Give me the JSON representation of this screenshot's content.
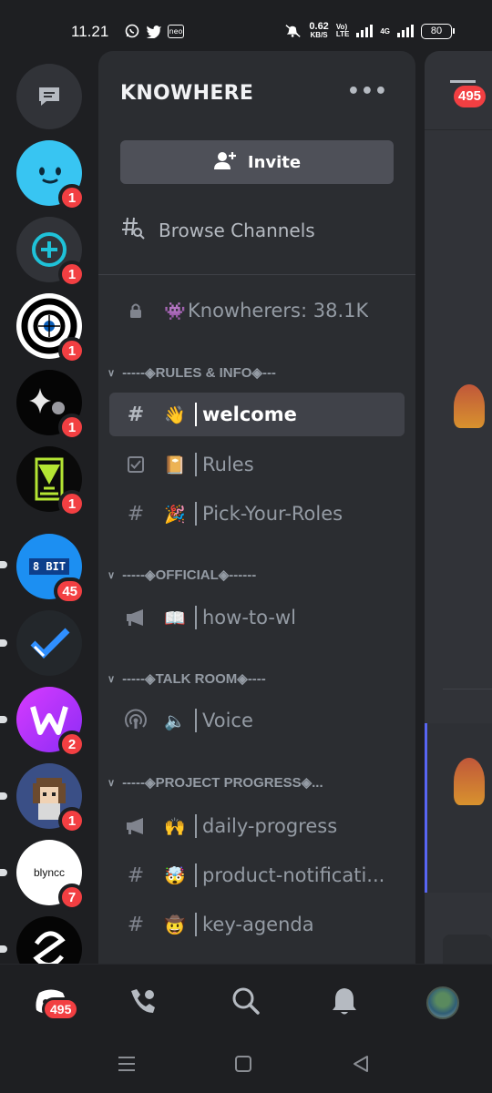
{
  "status_bar": {
    "time": "11.21",
    "neo": "neo",
    "speed": "0.62",
    "speed_unit": "KB/S",
    "volte_top": "Vo)",
    "volte_bottom": "LTE",
    "net": "4G",
    "battery": "80"
  },
  "rail": {
    "servers": [
      {
        "name": "direct-messages",
        "badge": ""
      },
      {
        "name": "smiley-server",
        "badge": "1"
      },
      {
        "name": "plus-server",
        "badge": "1"
      },
      {
        "name": "target-server",
        "badge": "1"
      },
      {
        "name": "sparkle-server",
        "badge": "1"
      },
      {
        "name": "gem-server",
        "badge": "1"
      },
      {
        "name": "8bit-server",
        "badge": "45",
        "text": "8 BIT"
      },
      {
        "name": "check-server",
        "badge": ""
      },
      {
        "name": "w-server",
        "badge": "2"
      },
      {
        "name": "pixel-avatar-server",
        "badge": "1"
      },
      {
        "name": "blyncc-server",
        "badge": "7",
        "text": "blyncc"
      },
      {
        "name": "knot-server",
        "badge": ""
      }
    ]
  },
  "panel": {
    "server_name": "KNOWHERE",
    "invite_label": "Invite",
    "browse_label": "Browse Channels",
    "members_row": {
      "emoji": "👾",
      "label": "Knowherers: 38.1K"
    },
    "categories": [
      {
        "label": "-----◈RULES & INFO◈---"
      },
      {
        "label": "-----◈OFFICIAL◈------"
      },
      {
        "label": "-----◈TALK ROOM◈----"
      },
      {
        "label": "-----◈PROJECT PROGRESS◈..."
      }
    ],
    "channels": [
      {
        "icon": "#",
        "emoji": "👋",
        "label": "welcome",
        "active": true
      },
      {
        "icon": "rules",
        "emoji": "📔",
        "label": "Rules"
      },
      {
        "icon": "#",
        "emoji": "🎉",
        "label": "Pick-Your-Roles"
      },
      {
        "icon": "announce",
        "emoji": "📖",
        "label": "how-to-wl"
      },
      {
        "icon": "voice",
        "emoji": "🔈",
        "label": "Voice"
      },
      {
        "icon": "announce",
        "emoji": "🙌",
        "label": "daily-progress"
      },
      {
        "icon": "#",
        "emoji": "🤯",
        "label": "product-notificati..."
      },
      {
        "icon": "#",
        "emoji": "🤠",
        "label": "key-agenda"
      }
    ]
  },
  "strip": {
    "badge": "495"
  },
  "bottom_nav": {
    "home_badge": "495",
    "items": [
      "home",
      "friends",
      "search",
      "notifications",
      "profile"
    ]
  }
}
